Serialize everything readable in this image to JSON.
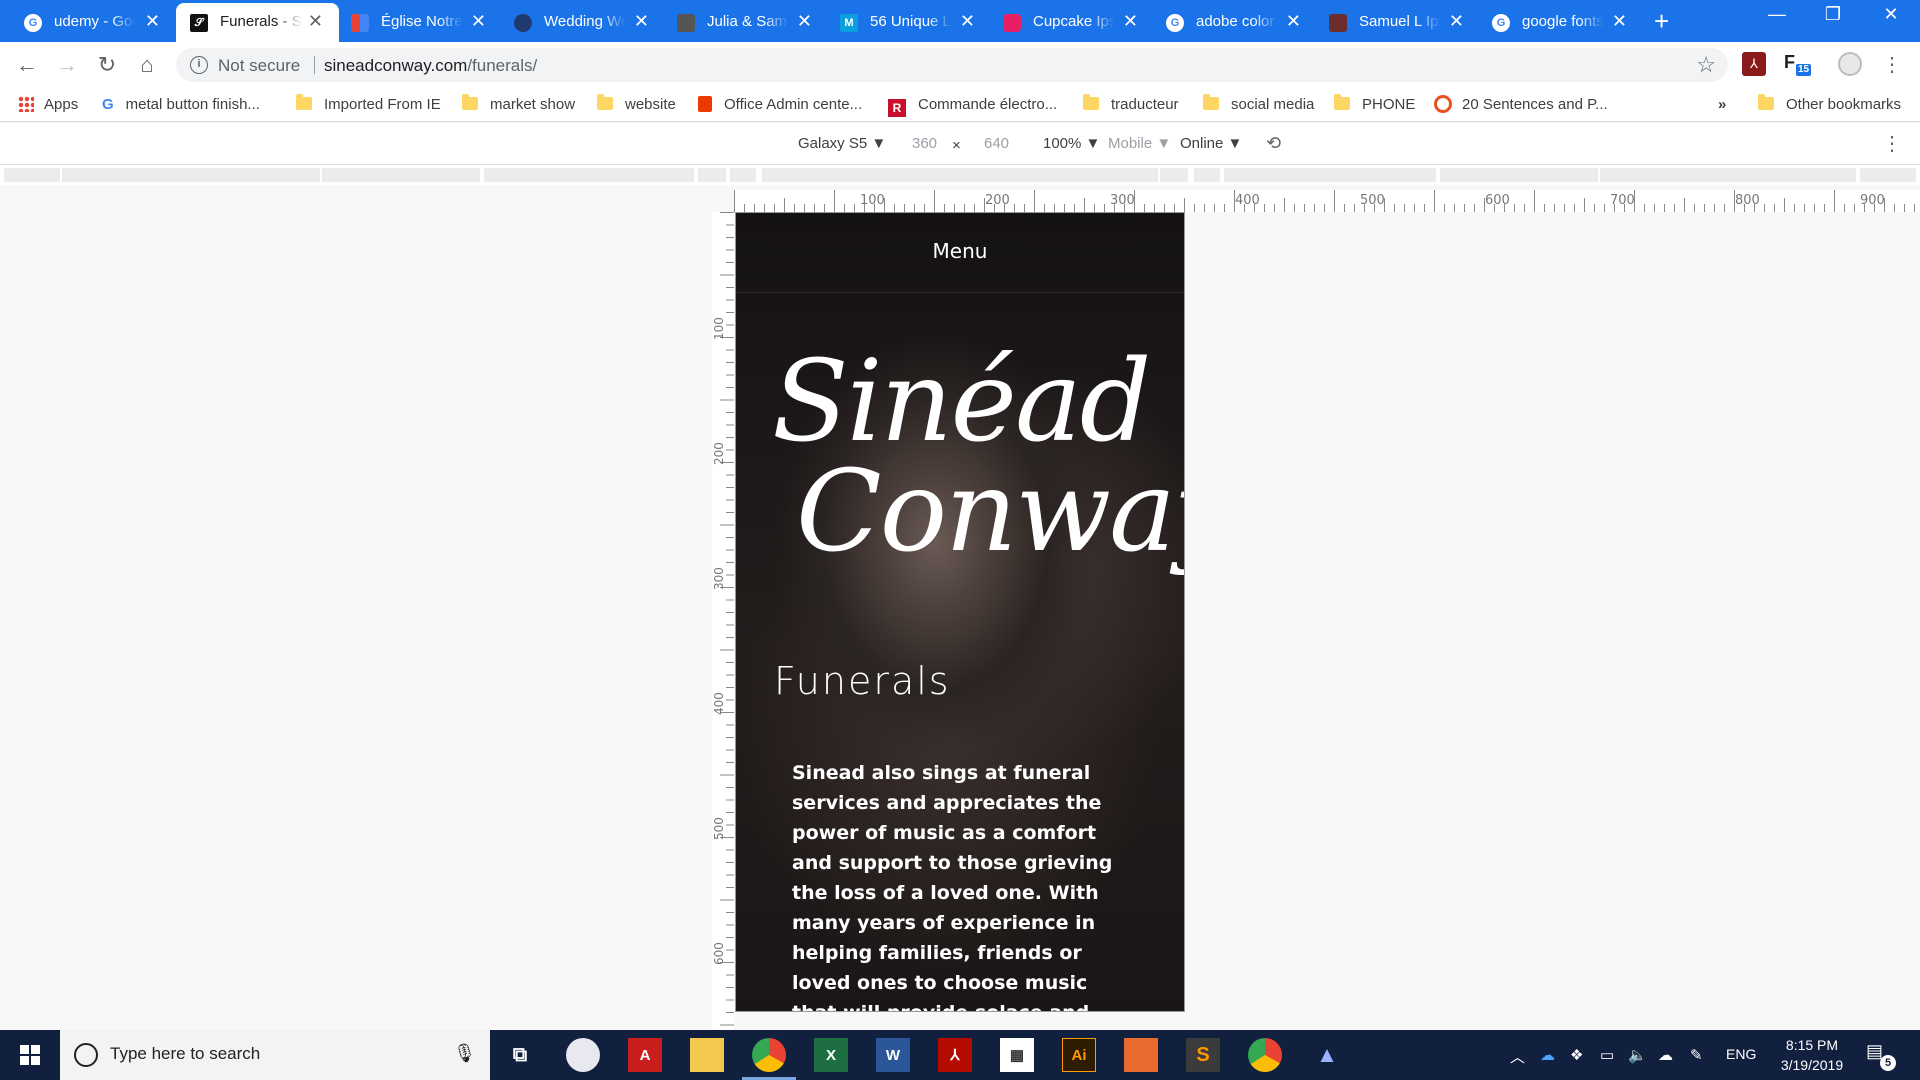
{
  "tabs": [
    {
      "title": "udemy - Goo",
      "favicon": "google-icon",
      "color": "#ffffff"
    },
    {
      "title": "Funerals - Si",
      "favicon": "signature-icon",
      "color": "#202124",
      "active": true
    },
    {
      "title": "Église Notre",
      "favicon": "puzzle-icon",
      "color": "#ffffff"
    },
    {
      "title": "Wedding We",
      "favicon": "spiral-icon",
      "color": "#ffffff"
    },
    {
      "title": "Julia & Sam",
      "favicon": "box-icon",
      "color": "#ffffff"
    },
    {
      "title": "56 Unique Lo",
      "favicon": "m-icon",
      "color": "#ffffff"
    },
    {
      "title": "Cupcake Ips",
      "favicon": "cupcake-icon",
      "color": "#ffffff"
    },
    {
      "title": "adobe color",
      "favicon": "google-icon",
      "color": "#ffffff"
    },
    {
      "title": "Samuel L Ips",
      "favicon": "portrait-icon",
      "color": "#ffffff"
    },
    {
      "title": "google fonts",
      "favicon": "google-icon",
      "color": "#ffffff"
    }
  ],
  "omnibox": {
    "security": "Not secure",
    "domain": "sineadconway.com",
    "path": "/funerals/"
  },
  "bookmarks": [
    {
      "label": "Apps",
      "icon": "apps-grid-icon"
    },
    {
      "label": "metal button finish...",
      "icon": "google-icon"
    },
    {
      "label": "Imported From IE",
      "icon": "folder-icon"
    },
    {
      "label": "market show",
      "icon": "folder-icon"
    },
    {
      "label": "website",
      "icon": "folder-icon"
    },
    {
      "label": "Office Admin cente...",
      "icon": "office-icon"
    },
    {
      "label": "Commande électro...",
      "icon": "r-icon"
    },
    {
      "label": "traducteur",
      "icon": "folder-icon"
    },
    {
      "label": "social media",
      "icon": "folder-icon"
    },
    {
      "label": "PHONE",
      "icon": "folder-icon"
    },
    {
      "label": "20 Sentences and P...",
      "icon": "ring-icon"
    }
  ],
  "bookmarks_more": "»",
  "other_bookmarks": "Other bookmarks",
  "device_toolbar": {
    "device": "Galaxy S5 ▼",
    "width": "360",
    "times": "×",
    "height": "640",
    "zoom": "100% ▼",
    "mode": "Mobile ▼",
    "network": "Online ▼"
  },
  "ruler": {
    "h_ticks": [
      "100",
      "200",
      "300",
      "400",
      "500",
      "600",
      "700",
      "800",
      "900"
    ],
    "v_ticks": [
      "100",
      "200",
      "300",
      "400",
      "500",
      "600"
    ]
  },
  "site": {
    "menu": "Menu",
    "logo_line1": "Sinéad",
    "logo_line2": "Conway",
    "heading": "Funerals",
    "body": "Sinead also sings at funeral services and appreciates the power of music as a comfort and support to those grieving the loss of a loved one. With many years of experience in helping families, friends or loved ones to choose music that will provide solace and comfort at this emotional time, Sinead is always"
  },
  "taskbar": {
    "search_placeholder": "Type here to search",
    "language": "ENG",
    "time": "8:15 PM",
    "date": "3/19/2019",
    "notifications": "5"
  },
  "extensions": {
    "badge": "15"
  }
}
